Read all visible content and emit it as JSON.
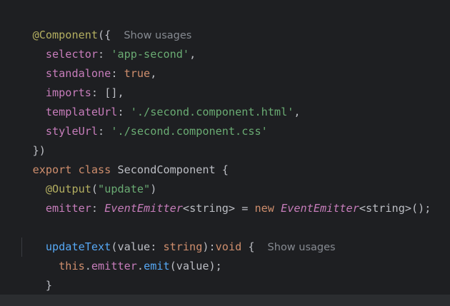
{
  "editor": {
    "show_usages": "Show usages",
    "decorator": {
      "name": "@Component",
      "open": "({",
      "selector_key": "selector",
      "selector_value": "'app-second'",
      "standalone_key": "standalone",
      "standalone_value": "true",
      "imports_key": "imports",
      "imports_value": "[]",
      "templateUrl_key": "templateUrl",
      "templateUrl_value": "'./second.component.html'",
      "styleUrl_key": "styleUrl",
      "styleUrl_value": "'./second.component.css'",
      "close": "})"
    },
    "class_decl": {
      "export": "export",
      "class": "class",
      "name": "SecondComponent",
      "brace": "{"
    },
    "output": {
      "name": "@Output",
      "arg": "\"update\""
    },
    "emitter_line": {
      "field": "emitter",
      "type": "EventEmitter",
      "generic": "<string>",
      "eq": " = ",
      "new": "new",
      "ctor": "EventEmitter",
      "generic2": "<string>",
      "end": "();"
    },
    "method": {
      "name": "updateText",
      "param": "value",
      "param_type": "string",
      "ret": "void",
      "brace": "{"
    },
    "body_line": {
      "this": "this",
      "dot1": ".",
      "field": "emitter",
      "dot2": ".",
      "call": "emit",
      "args": "(value);"
    },
    "method_close": "}",
    "class_close": "}"
  }
}
